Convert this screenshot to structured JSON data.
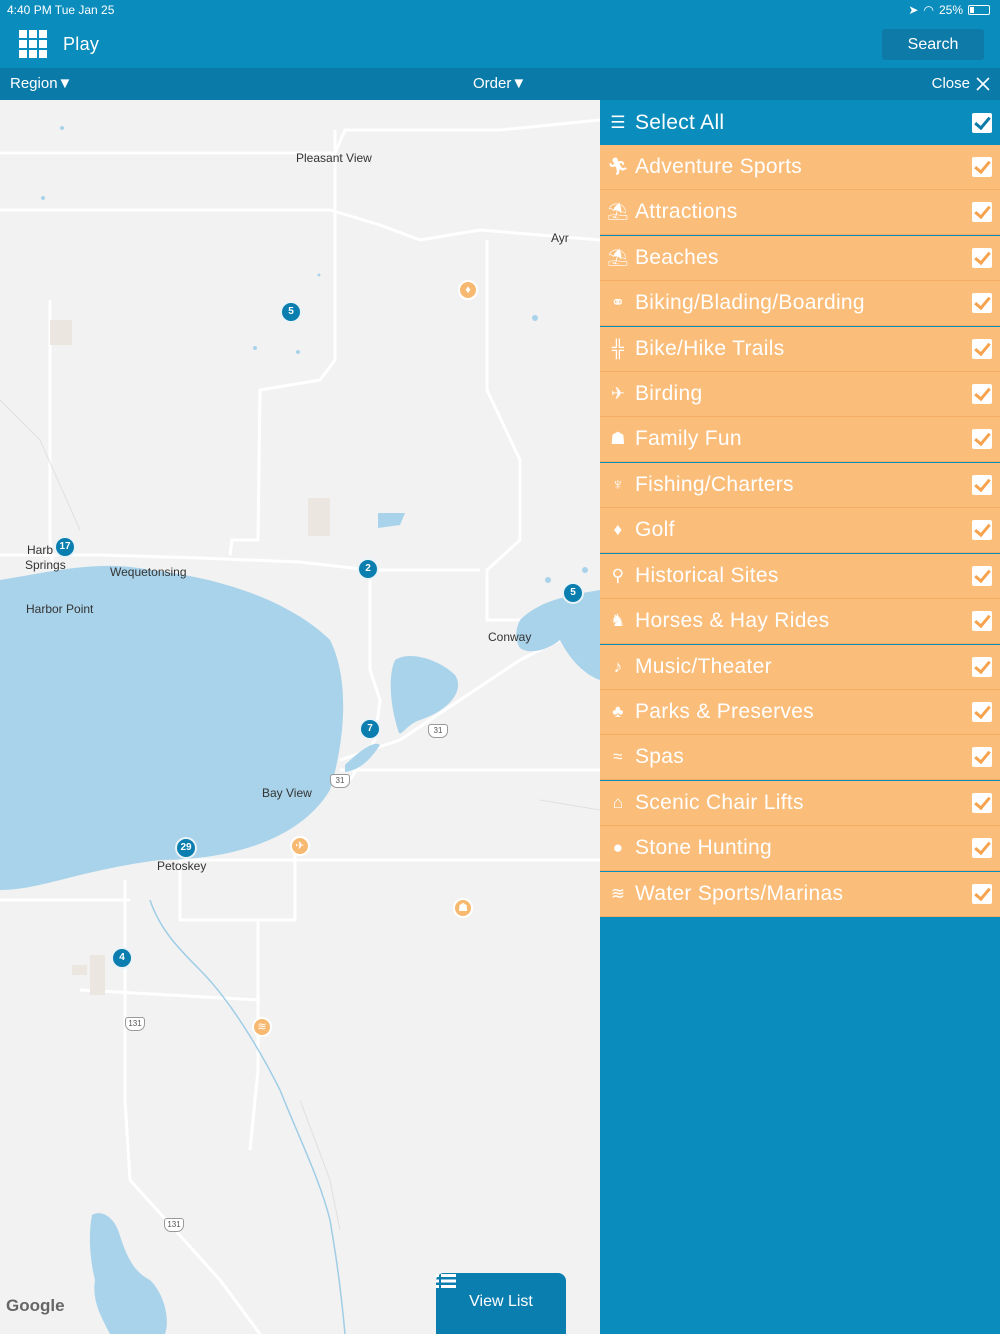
{
  "status": {
    "time": "4:40 PM  Tue Jan 25",
    "battery": "25%"
  },
  "header": {
    "title": "Play",
    "search_label": "Search"
  },
  "filterbar": {
    "region_label": "Region",
    "order_label": "Order",
    "close_label": "Close"
  },
  "map": {
    "places": [
      "Pleasant View",
      "Ayr",
      "Harb",
      "Springs",
      "Wequetonsing",
      "Harbor Point",
      "Conway",
      "Bay View",
      "Petoskey"
    ],
    "clusters": [
      "5",
      "17",
      "2",
      "5",
      "7",
      "29",
      "4"
    ],
    "shields": [
      "31",
      "31",
      "131",
      "131"
    ],
    "google_label": "Google",
    "view_list_label": "View List"
  },
  "panel": {
    "select_all": {
      "label": "Select All",
      "checked": true
    },
    "categories": [
      {
        "label": "Adventure Sports",
        "icon": "runner-icon",
        "checked": true
      },
      {
        "label": "Attractions",
        "icon": "carousel-icon",
        "checked": true
      },
      {
        "label": "Beaches",
        "icon": "beach-umbrella-icon",
        "checked": true
      },
      {
        "label": "Biking/Blading/Boarding",
        "icon": "bicycle-icon",
        "checked": true
      },
      {
        "label": "Bike/Hike Trails",
        "icon": "signpost-icon",
        "checked": true
      },
      {
        "label": "Birding",
        "icon": "bird-icon",
        "checked": true
      },
      {
        "label": "Family Fun",
        "icon": "family-icon",
        "checked": true
      },
      {
        "label": "Fishing/Charters",
        "icon": "fisherman-icon",
        "checked": true
      },
      {
        "label": "Golf",
        "icon": "golf-tee-icon",
        "checked": true
      },
      {
        "label": "Historical Sites",
        "icon": "map-pin-icon",
        "checked": true
      },
      {
        "label": "Horses & Hay Rides",
        "icon": "horse-icon",
        "checked": true
      },
      {
        "label": "Music/Theater",
        "icon": "performer-icon",
        "checked": true
      },
      {
        "label": "Parks & Preserves",
        "icon": "tree-icon",
        "checked": true
      },
      {
        "label": "Spas",
        "icon": "spa-stones-icon",
        "checked": true
      },
      {
        "label": "Scenic Chair Lifts",
        "icon": "gondola-icon",
        "checked": true
      },
      {
        "label": "Stone Hunting",
        "icon": "stone-icon",
        "checked": true
      },
      {
        "label": "Water Sports/Marinas",
        "icon": "waves-icon",
        "checked": true
      }
    ]
  },
  "colors": {
    "header": "#0a8cbc",
    "filterbar": "#0a7aa8",
    "category_row": "#fbbd7a",
    "water": "#a9d3ea",
    "cluster": "#0b7eb0",
    "poi": "#f7b870"
  }
}
